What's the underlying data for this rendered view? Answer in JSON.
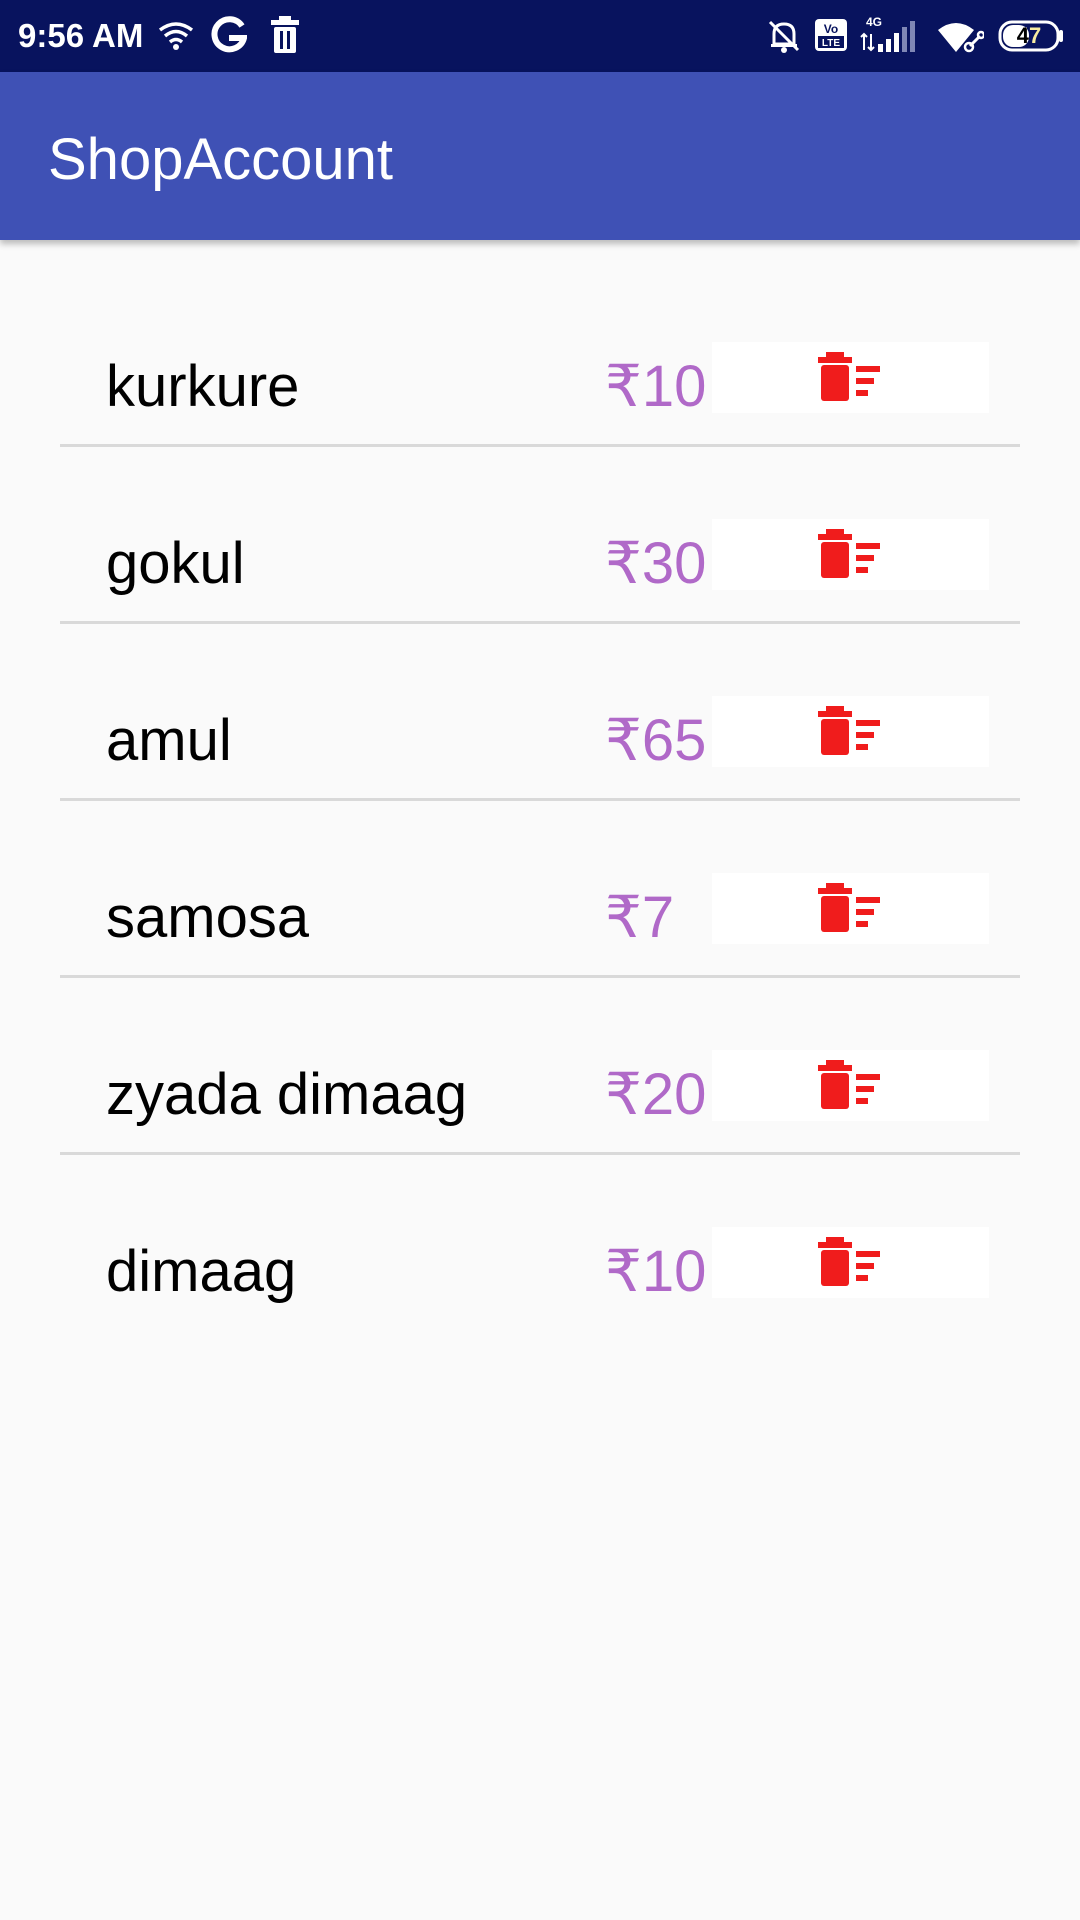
{
  "status_bar": {
    "time": "9:56 AM",
    "battery": "47",
    "network": "4G",
    "volte": "Vo LTE",
    "icons": [
      "wifi-icon",
      "google-icon",
      "trash-notification-icon",
      "mute-icon",
      "volte-icon",
      "signal-icon",
      "wifi-link-icon",
      "battery-icon"
    ]
  },
  "app_bar": {
    "title": "ShopAccount",
    "color": "#3f51b5"
  },
  "colors": {
    "status_bar": "#08135e",
    "price": "#b069c8",
    "delete_icon": "#f01c1c",
    "divider": "#d9d9d9"
  },
  "items": [
    {
      "name": "kurkure",
      "price": "₹10",
      "delete_icon": "delete-sweep-icon"
    },
    {
      "name": "gokul",
      "price": "₹30",
      "delete_icon": "delete-sweep-icon"
    },
    {
      "name": "amul",
      "price": "₹65",
      "delete_icon": "delete-sweep-icon"
    },
    {
      "name": "samosa",
      "price": "₹7",
      "delete_icon": "delete-sweep-icon"
    },
    {
      "name": "zyada dimaag",
      "price": "₹20",
      "delete_icon": "delete-sweep-icon"
    },
    {
      "name": "dimaag",
      "price": "₹10",
      "delete_icon": "delete-sweep-icon"
    }
  ]
}
